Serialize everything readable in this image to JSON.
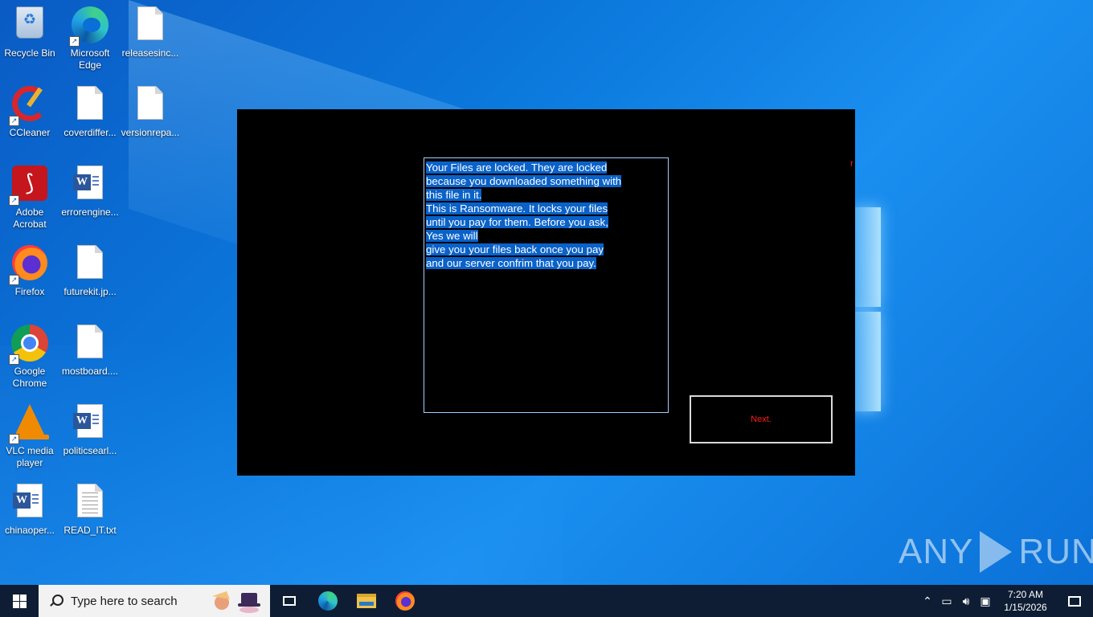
{
  "desktop": {
    "icons": [
      {
        "label": "Recycle Bin"
      },
      {
        "label": "Microsoft Edge"
      },
      {
        "label": "releasesinc..."
      },
      {
        "label": "CCleaner"
      },
      {
        "label": "coverdiffer..."
      },
      {
        "label": "versionrepa..."
      },
      {
        "label": "Adobe Acrobat"
      },
      {
        "label": "errorengine..."
      },
      {
        "label": "Firefox"
      },
      {
        "label": "futurekit.jp..."
      },
      {
        "label": "Google Chrome"
      },
      {
        "label": "mostboard...."
      },
      {
        "label": "VLC media player"
      },
      {
        "label": "politicsearl..."
      },
      {
        "label": "chinaoper..."
      },
      {
        "label": "READ_IT.txt"
      }
    ]
  },
  "ransom_window": {
    "lines": [
      "Your Files are locked. They are locked",
      "because you downloaded something with",
      "this file in it.",
      "This is Ransomware. It locks your files",
      "until you pay for them. Before you ask,",
      "Yes we will",
      "give you your files back once you pay",
      "and our server confrim that you pay."
    ],
    "red_mark": "r",
    "next_button": "Next."
  },
  "watermark": {
    "left": "ANY",
    "right": "RUN"
  },
  "taskbar": {
    "search_placeholder": "Type here to search",
    "time": "7:20 AM",
    "date": "1/15/2026"
  },
  "colors": {
    "selection": "#0a62c9",
    "next_text": "#ff1a1a",
    "window_bg": "#000000"
  }
}
